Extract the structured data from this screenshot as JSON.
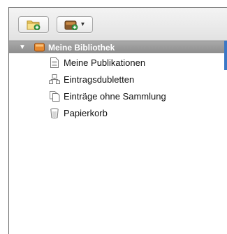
{
  "toolbar": {
    "new_collection_icon": "new-collection-icon",
    "new_library_icon": "new-library-icon",
    "dropdown_arrow": "▼"
  },
  "tree": {
    "library": {
      "disclosure": "▼",
      "label": "Meine Bibliothek",
      "icon": "library-icon"
    },
    "items": [
      {
        "label": "Meine Publikationen",
        "icon": "document-icon"
      },
      {
        "label": "Eintragsdubletten",
        "icon": "duplicates-icon"
      },
      {
        "label": "Einträge ohne Sammlung",
        "icon": "unfiled-icon"
      },
      {
        "label": "Papierkorb",
        "icon": "trash-icon"
      }
    ]
  },
  "colors": {
    "selection_bg": "#9b9b9b",
    "accent": "#3b78c6",
    "folder_yellow": "#f2c94c",
    "library_orange": "#e07a2e"
  }
}
